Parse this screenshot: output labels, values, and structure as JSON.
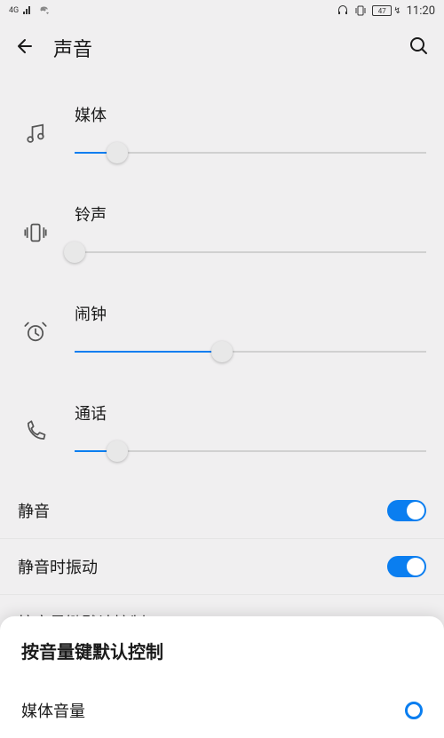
{
  "status": {
    "network": "4G",
    "battery_level": "47",
    "time": "11:20"
  },
  "header": {
    "title": "声音"
  },
  "sliders": {
    "media": {
      "label": "媒体",
      "percent": 12
    },
    "ringtone": {
      "label": "铃声",
      "percent": 0
    },
    "alarm": {
      "label": "闹钟",
      "percent": 42
    },
    "call": {
      "label": "通话",
      "percent": 12
    }
  },
  "toggles": {
    "mute": {
      "label": "静音",
      "on": true
    },
    "vibrate_on_mute": {
      "label": "静音时振动",
      "on": true
    }
  },
  "link": {
    "label": "按音量键默认控制",
    "value": "媒体音量"
  },
  "popup": {
    "title": "按音量键默认控制",
    "option_media": "媒体音量"
  }
}
